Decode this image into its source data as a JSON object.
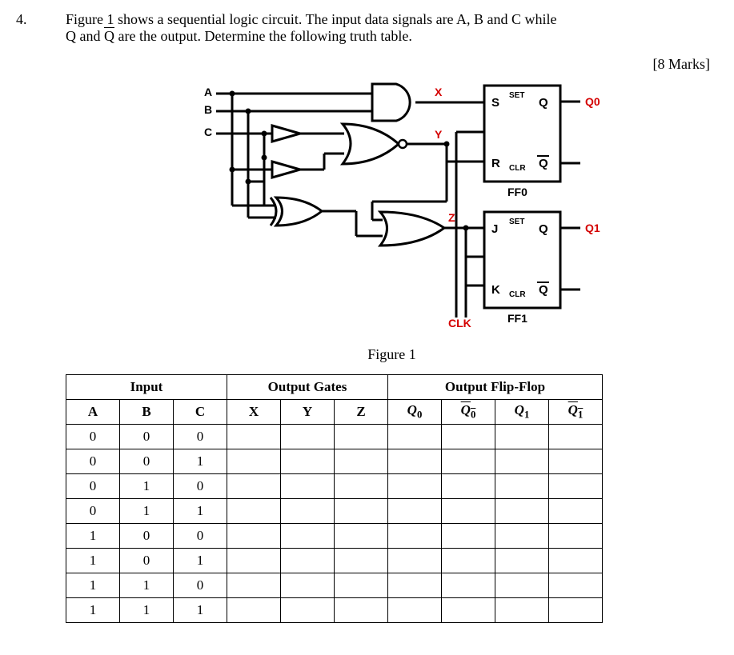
{
  "question_number": "4.",
  "question_text_line1": "Figure 1 shows a sequential logic circuit. The input data signals are A, B and C while",
  "question_text_line2": "Q and Q̄ are the output. Determine the following truth table.",
  "marks": "[8 Marks]",
  "figure_caption": "Figure 1",
  "circuit": {
    "inputs": {
      "A": "A",
      "B": "B",
      "C": "C"
    },
    "wires": {
      "X": "X",
      "Y": "Y",
      "Z": "Z",
      "CLK": "CLK"
    },
    "ff0": {
      "name": "FF0",
      "S": "S",
      "R": "R",
      "SET": "SET",
      "CLR": "CLR",
      "Q": "Q",
      "Qbar": "Q",
      "out": "Q0"
    },
    "ff1": {
      "name": "FF1",
      "J": "J",
      "K": "K",
      "SET": "SET",
      "CLR": "CLR",
      "Q": "Q",
      "Qbar": "Q",
      "out": "Q1"
    }
  },
  "table": {
    "group_headers": {
      "input": "Input",
      "gates": "Output Gates",
      "ff": "Output Flip-Flop"
    },
    "col_headers": {
      "A": "A",
      "B": "B",
      "C": "C",
      "X": "X",
      "Y": "Y",
      "Z": "Z",
      "Q0": "Q",
      "Q0b": "Q",
      "Q1": "Q",
      "Q1b": "Q",
      "sub0": "0",
      "sub1": "1"
    },
    "rows": [
      {
        "A": "0",
        "B": "0",
        "C": "0"
      },
      {
        "A": "0",
        "B": "0",
        "C": "1"
      },
      {
        "A": "0",
        "B": "1",
        "C": "0"
      },
      {
        "A": "0",
        "B": "1",
        "C": "1"
      },
      {
        "A": "1",
        "B": "0",
        "C": "0"
      },
      {
        "A": "1",
        "B": "0",
        "C": "1"
      },
      {
        "A": "1",
        "B": "1",
        "C": "0"
      },
      {
        "A": "1",
        "B": "1",
        "C": "1"
      }
    ]
  }
}
